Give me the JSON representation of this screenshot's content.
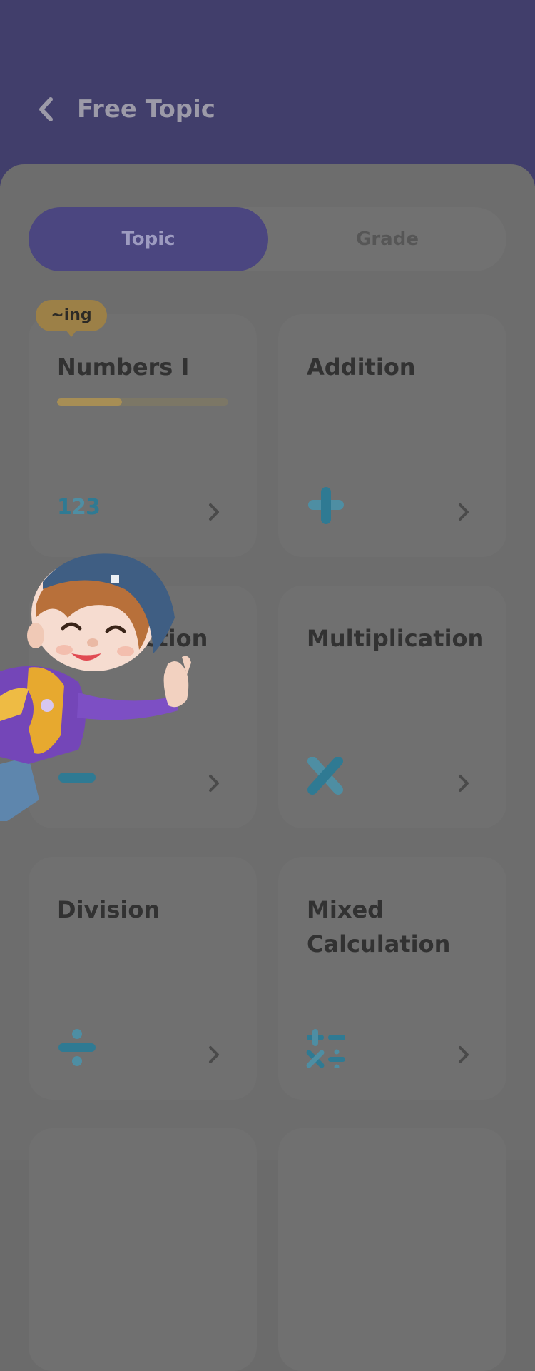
{
  "header": {
    "title": "Free Topic"
  },
  "tabs": [
    {
      "label": "Topic"
    },
    {
      "label": "Grade"
    }
  ],
  "badge": {
    "label": "~ing"
  },
  "cards": [
    {
      "title": "Numbers I",
      "progress": 0.38,
      "icon": "numbers-123-icon"
    },
    {
      "title": "Addition",
      "icon": "plus-icon"
    },
    {
      "title": "Subtraction",
      "icon": "minus-icon"
    },
    {
      "title": "Multiplication",
      "icon": "multiply-icon"
    },
    {
      "title": "Division",
      "icon": "divide-icon"
    },
    {
      "title": "Mixed Calculation",
      "icon": "mixed-operations-icon"
    }
  ],
  "colors": {
    "header": "#413e6b",
    "accent": "#4b4680",
    "icon_teal": "#2f7a93",
    "badge": "#9c8047"
  }
}
